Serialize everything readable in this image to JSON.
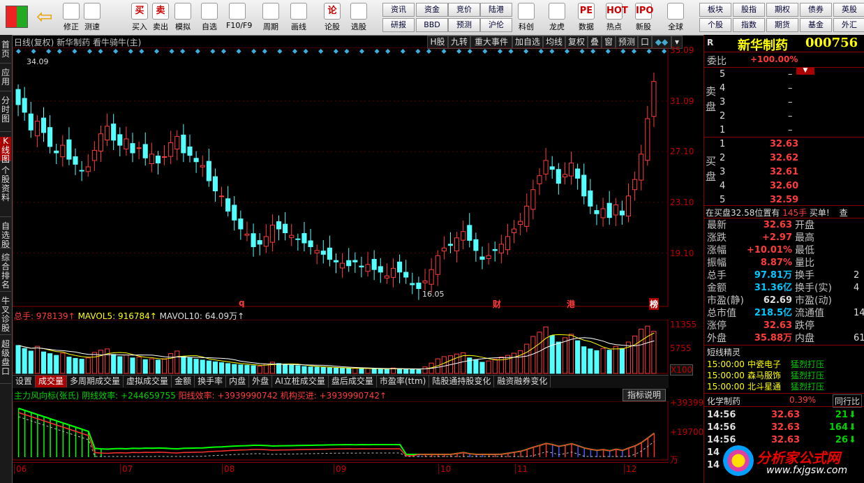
{
  "toolbar": {
    "buttons": [
      {
        "label": "修正",
        "icon": "up-arrow-icon"
      },
      {
        "label": "测速",
        "icon": "clock-icon"
      },
      {
        "label": "买入",
        "icon": "buy-icon",
        "glyph": "买"
      },
      {
        "label": "卖出",
        "icon": "sell-icon",
        "glyph": "卖"
      },
      {
        "label": "模拟",
        "icon": "hammer-icon"
      },
      {
        "label": "自选",
        "icon": "watchlist-icon"
      },
      {
        "label": "F10/F9",
        "icon": "f10-icon"
      },
      {
        "label": "周期",
        "icon": "period-icon"
      },
      {
        "label": "画线",
        "icon": "pen-icon"
      },
      {
        "label": "论股",
        "icon": "discussion-icon",
        "glyph": "论"
      },
      {
        "label": "选股",
        "icon": "stock-picker-icon"
      },
      {
        "label": "科创",
        "icon": "star-market-icon"
      },
      {
        "label": "龙虎",
        "icon": "dragon-tiger-icon"
      },
      {
        "label": "数据",
        "icon": "data-icon",
        "glyph": "PE"
      },
      {
        "label": "热点",
        "icon": "hot-icon",
        "glyph": "HOT"
      },
      {
        "label": "新股",
        "icon": "ipo-icon",
        "glyph": "IPO"
      },
      {
        "label": "全球",
        "icon": "globe-icon"
      }
    ],
    "quick": [
      [
        "资讯",
        "研报"
      ],
      [
        "资金",
        "BBD"
      ],
      [
        "竞价",
        "预测"
      ],
      [
        "陆港",
        "沪伦"
      ],
      [
        "板块",
        "个股"
      ],
      [
        "股指",
        "指数"
      ],
      [
        "期权",
        "期货"
      ],
      [
        "债券",
        "基金"
      ],
      [
        "英股",
        "外汇"
      ]
    ]
  },
  "left_tabs": [
    "首页",
    "应用",
    "分时图",
    "K线图",
    "个股资料",
    "自选股",
    "综合排名",
    "牛叉诊股",
    "超级盘口"
  ],
  "chart": {
    "header": "日线(复权) 新华制药 看牛骑牛(主)",
    "tool_buttons": [
      "H股",
      "九转",
      "重大事件",
      "加自选",
      "均线",
      "复权",
      "叠",
      "窗",
      "预测",
      "口"
    ],
    "price_axis": [
      "35.09",
      "31.09",
      "27.10",
      "23.10",
      "19.10"
    ],
    "high_label": "34.09",
    "low_label": "16.05",
    "events": [
      "q",
      "财",
      "港",
      "榜"
    ],
    "vol_header": {
      "total": "总手: 978139↑",
      "mavol5": "MAVOL5: 916784↑",
      "mavol10": "MAVOL10: 64.09万↑"
    },
    "vol_axis": [
      "11355",
      "5755",
      "X100"
    ],
    "sub_tabs": [
      "设置",
      "成交量",
      "多周期成交量",
      "虚拟成交量",
      "金额",
      "换手率",
      "内盘",
      "外盘",
      "AI立桩成交量",
      "盘后成交量",
      "市盈率(ttm)",
      "陆股通持股变化",
      "融资融券变化"
    ],
    "ind_header": {
      "name": "主力风向标(张氏)",
      "yin": "阴线效率: +244659755",
      "yang": "阳线效率: +3939990742",
      "inst": "机构买进: +3939990742↑"
    },
    "ind_button": "指标说明",
    "ind_axis": [
      "+393999",
      "+197000",
      "万"
    ],
    "months": [
      "06",
      "07",
      "08",
      "09",
      "10",
      "11",
      "12"
    ]
  },
  "quote": {
    "code_tag": "R",
    "name": "新华制药",
    "code": "000756",
    "ratio_label": "委比",
    "ratio_value": "+100.00%",
    "sell_label": "卖盘",
    "buy_label": "买盘",
    "sell": [
      [
        "5",
        "–"
      ],
      [
        "4",
        "–"
      ],
      [
        "3",
        "–"
      ],
      [
        "2",
        "–"
      ],
      [
        "1",
        "–"
      ]
    ],
    "buy": [
      [
        "1",
        "32.63"
      ],
      [
        "2",
        "32.62"
      ],
      [
        "3",
        "32.61"
      ],
      [
        "4",
        "32.60"
      ],
      [
        "5",
        "32.59"
      ]
    ],
    "notice": {
      "text": "在买盘32.58位置有",
      "qty": "145手",
      "tag": "买单!",
      "extra": "查"
    },
    "stats": [
      [
        "最新",
        "32.63",
        "开盘",
        ""
      ],
      [
        "涨跌",
        "+2.97",
        "最高",
        ""
      ],
      [
        "涨幅",
        "+10.01%",
        "最低",
        ""
      ],
      [
        "振幅",
        "8.87%",
        "量比",
        ""
      ],
      [
        "总手",
        "97.81万",
        "换手",
        "2"
      ],
      [
        "金额",
        "31.36亿",
        "换手(实)",
        "4"
      ],
      [
        "市盈(静)",
        "62.69",
        "市盈(动)",
        ""
      ],
      [
        "总市值",
        "218.5亿",
        "流通值",
        "14"
      ],
      [
        "涨停",
        "32.63",
        "跌停",
        ""
      ],
      [
        "外盘",
        "35.88万",
        "内盘",
        "61"
      ]
    ],
    "short_title": "短线精灵",
    "short": [
      [
        "15:00:00",
        "中瓷电子",
        "猛烈打压"
      ],
      [
        "15:00:00",
        "森马服饰",
        "猛烈打压"
      ],
      [
        "15:00:00",
        "北斗星通",
        "猛烈打压"
      ]
    ],
    "sector": {
      "name": "化学制药",
      "change": "0.39%",
      "tab": "同行比"
    },
    "ticks": [
      [
        "14:56",
        "32.63",
        "21"
      ],
      [
        "14:56",
        "32.63",
        "164"
      ],
      [
        "14:56",
        "32.63",
        "26"
      ],
      [
        "14",
        "",
        ""
      ],
      [
        "14",
        "",
        ""
      ]
    ]
  },
  "watermark": {
    "title": "分析家公式网",
    "url": "www.fxjgsw.com"
  },
  "chart_data": {
    "type": "candlestick",
    "ylim": [
      16.05,
      35.09
    ],
    "high": 34.09,
    "low": 16.05,
    "close_last": 32.63,
    "closes": [
      30.8,
      30.2,
      28.8,
      29.5,
      28.6,
      27.5,
      27.0,
      27.6,
      26.5,
      26.1,
      25.6,
      25.9,
      27.2,
      28.5,
      29.1,
      28.0,
      27.6,
      28.1,
      27.0,
      27.4,
      26.6,
      26.9,
      26.2,
      26.7,
      27.8,
      28.3,
      27.0,
      26.8,
      26.3,
      26.0,
      24.8,
      24.0,
      23.6,
      22.4,
      21.7,
      21.0,
      20.6,
      19.6,
      19.8,
      20.4,
      21.3,
      21.0,
      20.7,
      20.5,
      20.2,
      19.9,
      19.6,
      19.3,
      19.0,
      18.6,
      18.4,
      18.3,
      18.1,
      18.4,
      18.0,
      18.2,
      17.8,
      17.6,
      17.3,
      17.9,
      17.6,
      17.2,
      16.6,
      16.3,
      16.9,
      17.8,
      18.9,
      19.5,
      19.7,
      20.3,
      20.8,
      20.1,
      19.3,
      18.6,
      18.9,
      19.3,
      19.8,
      20.4,
      21.0,
      21.6,
      22.8,
      24.1,
      25.2,
      26.4,
      25.7,
      24.6,
      25.3,
      26.2,
      25.0,
      23.6,
      22.8,
      22.2,
      22.6,
      21.9,
      22.9,
      22.1,
      23.6,
      24.9,
      26.9,
      29.7,
      32.63
    ],
    "volumes": [
      6500,
      5800,
      5200,
      6300,
      5000,
      4600,
      4200,
      4700,
      3800,
      3500,
      3300,
      3600,
      4900,
      5400,
      5700,
      4400,
      3900,
      4300,
      3600,
      3800,
      3200,
      3400,
      3100,
      3300,
      4600,
      5200,
      3900,
      3600,
      3300,
      3100,
      2900,
      2700,
      2500,
      2300,
      2100,
      2000,
      1900,
      1800,
      1700,
      2200,
      2600,
      2300,
      2100,
      1900,
      1800,
      1600,
      1500,
      1450,
      1400,
      1300,
      1250,
      1200,
      1150,
      1200,
      1100,
      1150,
      1050,
      1000,
      950,
      1250,
      1100,
      1000,
      900,
      850,
      1500,
      2400,
      3400,
      3900,
      4100,
      4500,
      4800,
      3600,
      3200,
      2600,
      2900,
      3300,
      3800,
      4200,
      4700,
      5300,
      6800,
      8600,
      9600,
      10800,
      8800,
      7300,
      8300,
      9100,
      7600,
      6200,
      5700,
      5300,
      5800,
      5400,
      6300,
      5800,
      7300,
      8700,
      10300,
      11000,
      9781
    ]
  }
}
